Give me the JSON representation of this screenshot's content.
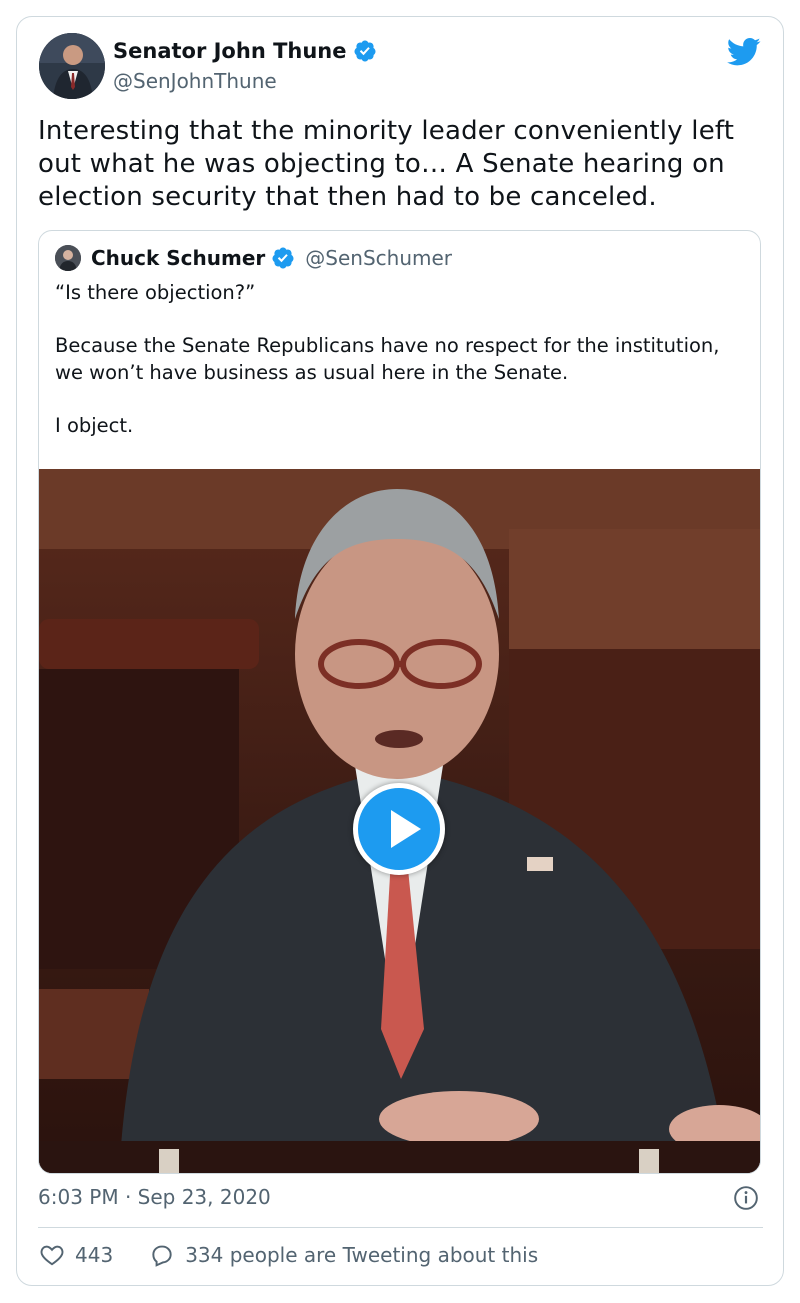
{
  "author": {
    "display_name": "Senator John Thune",
    "handle": "@SenJohnThune",
    "verified": true
  },
  "tweet": {
    "text": "Interesting that the minority leader conveniently left out what he was objecting to… A Senate hearing on election security that then had to be canceled."
  },
  "quoted_tweet": {
    "display_name": "Chuck Schumer",
    "handle": "@SenSchumer",
    "verified": true,
    "paragraphs": [
      "“Is there objection?”",
      "Because the Senate Republicans have no respect for the institution, we won’t have business as usual here in the Senate.",
      "I object."
    ],
    "media": {
      "type": "video",
      "icon": "play-icon"
    }
  },
  "footer": {
    "timestamp": "6:03 PM · Sep 23, 2020",
    "likes": "443",
    "replies_label": "334 people are Tweeting about this"
  },
  "colors": {
    "accent": "#1d9bf0",
    "text": "#0f1419",
    "secondary": "#536471",
    "border": "#cfd9de"
  },
  "icons": [
    "twitter-bird-icon",
    "verified-badge-icon",
    "info-icon",
    "heart-icon",
    "reply-bubble-icon",
    "play-icon"
  ]
}
